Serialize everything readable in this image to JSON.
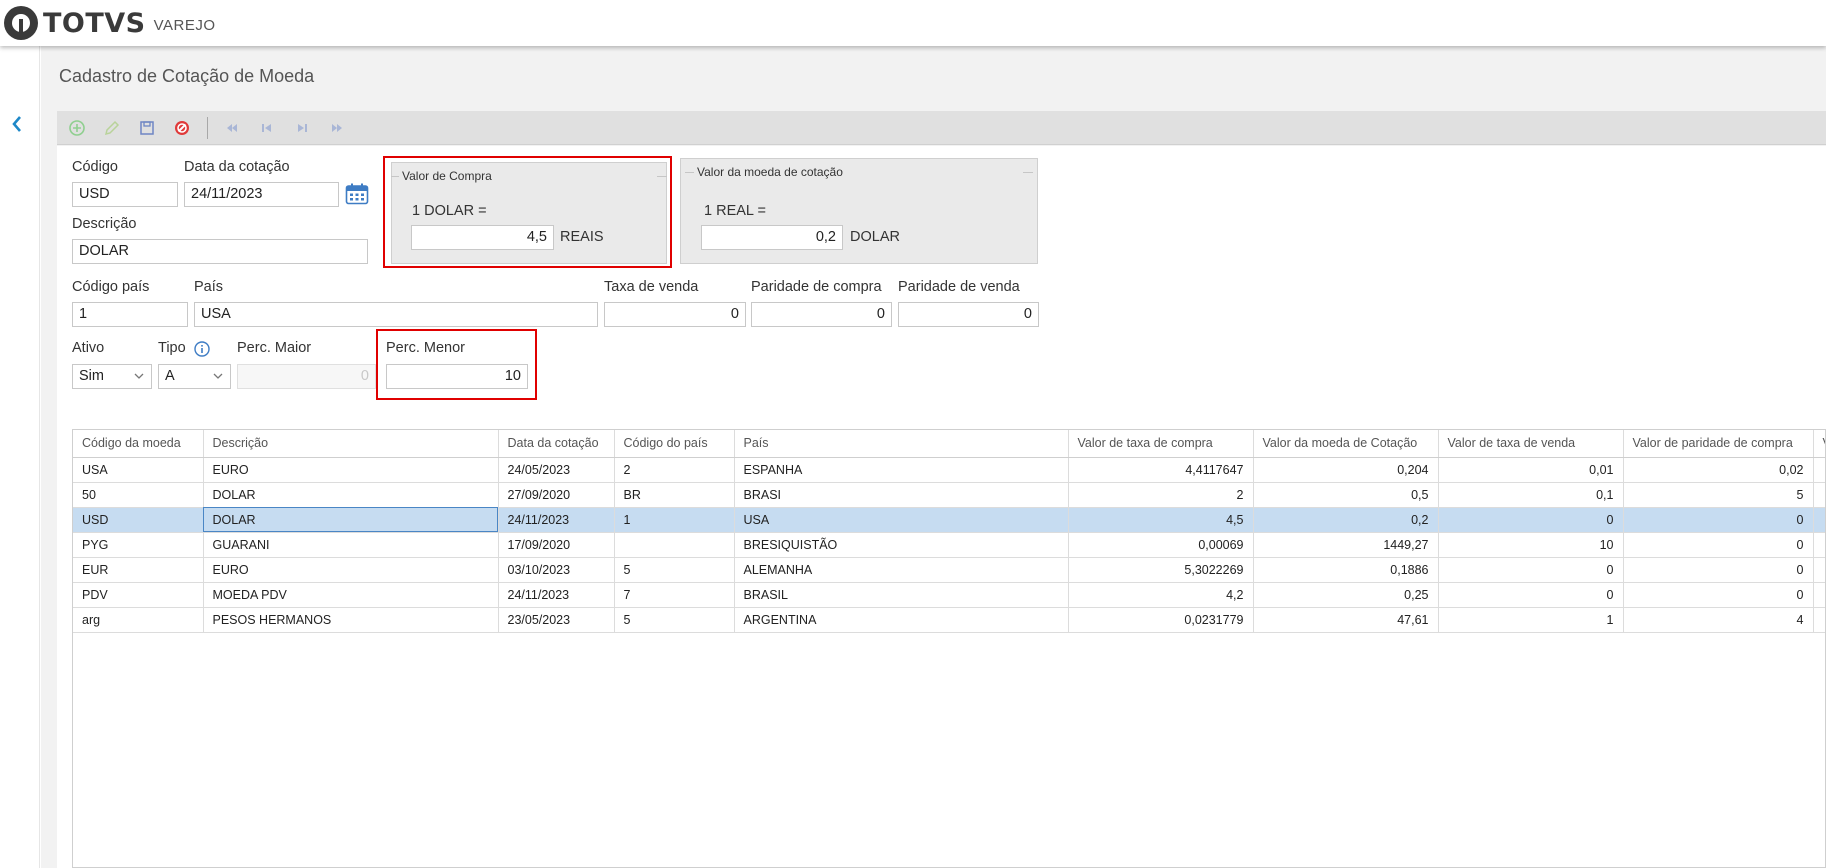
{
  "app": {
    "brand": "TOTVS",
    "brand_sub": "VAREJO"
  },
  "page": {
    "title": "Cadastro de Cotação de Moeda"
  },
  "toolbar": {
    "buttons": [
      "add-icon",
      "edit-icon",
      "save-icon",
      "cancel-icon",
      "first-icon",
      "previous-icon",
      "next-icon",
      "last-icon"
    ]
  },
  "form": {
    "codigo": {
      "label": "Código",
      "value": "USD"
    },
    "data_cotacao": {
      "label": "Data da cotação",
      "value": "24/11/2023"
    },
    "descricao": {
      "label": "Descrição",
      "value": "DOLAR"
    },
    "valor_compra": {
      "title": "Valor de Compra",
      "line": "1 DOLAR =",
      "value": "4,5",
      "unit": "REAIS"
    },
    "valor_moeda": {
      "title": "Valor da moeda de cotação",
      "line": "1 REAL =",
      "value": "0,2",
      "unit": "DOLAR"
    },
    "codigo_pais": {
      "label": "Código país",
      "value": "1"
    },
    "pais": {
      "label": "País",
      "value": "USA"
    },
    "taxa_venda": {
      "label": "Taxa de venda",
      "value": "0"
    },
    "paridade_compra": {
      "label": "Paridade de compra",
      "value": "0"
    },
    "paridade_venda": {
      "label": "Paridade de venda",
      "value": "0"
    },
    "ativo": {
      "label": "Ativo",
      "value": "Sim"
    },
    "tipo": {
      "label": "Tipo",
      "value": "A"
    },
    "perc_maior": {
      "label": "Perc. Maior",
      "value": "0"
    },
    "perc_menor": {
      "label": "Perc. Menor",
      "value": "10"
    }
  },
  "grid": {
    "columns": [
      "Código da moeda",
      "Descrição",
      "Data da cotação",
      "Código do país",
      "País",
      "Valor de taxa de compra",
      "Valor da moeda de Cotação",
      "Valor de taxa de venda",
      "Valor de paridade de compra",
      "V"
    ],
    "rows": [
      [
        "USA",
        "EURO",
        "24/05/2023",
        "2",
        "ESPANHA",
        "4,4117647",
        "0,204",
        "0,01",
        "0,02"
      ],
      [
        "50",
        "DOLAR",
        "27/09/2020",
        "BR",
        "BRASI",
        "2",
        "0,5",
        "0,1",
        "5"
      ],
      [
        "USD",
        "DOLAR",
        "24/11/2023",
        "1",
        "USA",
        "4,5",
        "0,2",
        "0",
        "0"
      ],
      [
        "PYG",
        "GUARANI",
        "17/09/2020",
        "",
        "BRESIQUISTÃO",
        "0,00069",
        "1449,27",
        "10",
        "0"
      ],
      [
        "EUR",
        "EURO",
        "03/10/2023",
        "5",
        "ALEMANHA",
        "5,3022269",
        "0,1886",
        "0",
        "0"
      ],
      [
        "PDV",
        "MOEDA PDV",
        "24/11/2023",
        "7",
        "BRASIL",
        "4,2",
        "0,25",
        "0",
        "0"
      ],
      [
        "arg",
        "PESOS HERMANOS",
        "23/05/2023",
        "5",
        "ARGENTINA",
        "0,0231779",
        "47,61",
        "1",
        "4"
      ]
    ],
    "selected_row": 2
  },
  "colors": {
    "accent": "#1e88c8",
    "highlight_box": "#e00000",
    "selected_row": "#c6dcf1"
  }
}
